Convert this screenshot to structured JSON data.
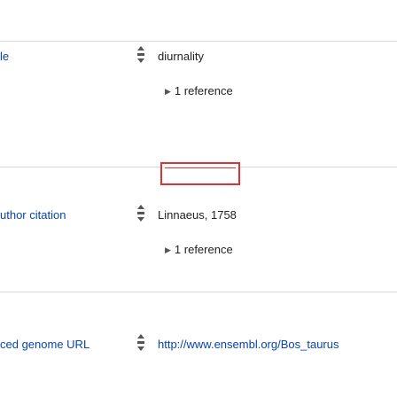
{
  "rows": [
    {
      "property": "le",
      "value": "diurnality",
      "reference": "1 reference"
    },
    {
      "property": "uthor citation",
      "value": "Linnaeus, 1758",
      "reference": "1 reference"
    },
    {
      "property": "ced genome URL",
      "value": "http://www.ensembl.org/Bos_taurus"
    }
  ],
  "colors": {
    "link": "#0645ad",
    "divider": "#d4d6d9",
    "highlight_box": "#dd3333"
  },
  "icons": {
    "rank": "normal-rank-icon",
    "expand": "triangle-right-icon"
  }
}
